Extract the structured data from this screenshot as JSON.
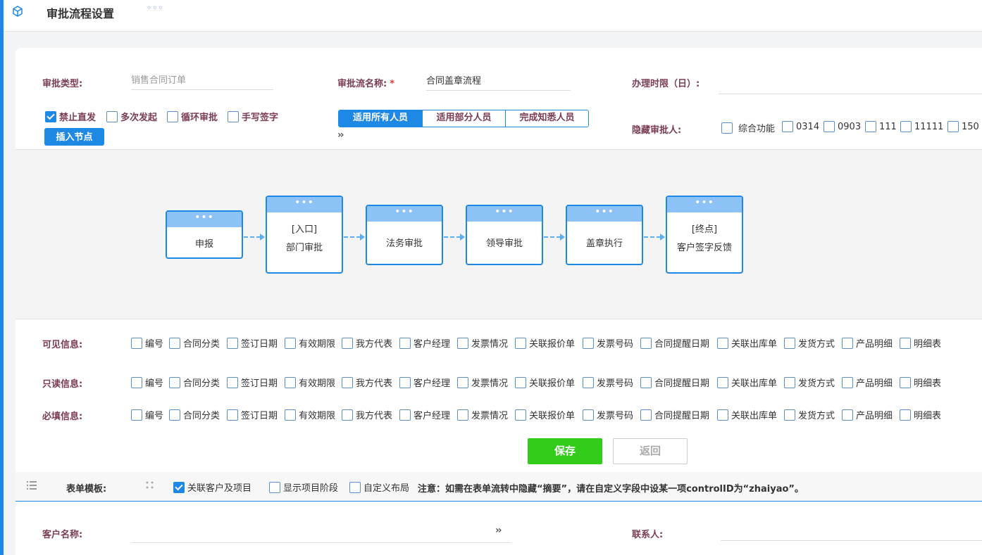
{
  "header": {
    "title": "审批流程设置",
    "more": "◦◦◦"
  },
  "form": {
    "type_label": "审批类型:",
    "type_placeholder": "销售合同订单",
    "name_label": "审批流名称:",
    "name_required": "*",
    "name_value": "合同盖章流程",
    "deadline_label": "办理时限（日）:",
    "deadline_value": ""
  },
  "options": [
    {
      "label": "禁止直发",
      "checked": true
    },
    {
      "label": "多次发起",
      "checked": false
    },
    {
      "label": "循环审批",
      "checked": false
    },
    {
      "label": "手写签字",
      "checked": false
    }
  ],
  "insert_node_label": "插入节点",
  "scope_tabs": [
    {
      "label": "适用所有人员",
      "active": true
    },
    {
      "label": "适用部分人员",
      "active": false
    },
    {
      "label": "完成知悉人员",
      "active": false
    }
  ],
  "hidden_approver": {
    "label": "隐藏审批人:",
    "items": [
      "综合功能",
      "0314",
      "0903",
      "111",
      "11111",
      "150"
    ]
  },
  "flow_nodes": [
    {
      "line1": "",
      "line2": "申报"
    },
    {
      "line1": "[入口]",
      "line2": "部门审批"
    },
    {
      "line1": "",
      "line2": "法务审批"
    },
    {
      "line1": "",
      "line2": "领导审批"
    },
    {
      "line1": "",
      "line2": "盖章执行"
    },
    {
      "line1": "[终点]",
      "line2": "客户签字反馈"
    }
  ],
  "node_head": "•••",
  "fields": [
    "编号",
    "合同分类",
    "签订日期",
    "有效期限",
    "我方代表",
    "客户经理",
    "发票情况",
    "关联报价单",
    "发票号码",
    "合同提醒日期",
    "关联出库单",
    "发货方式",
    "产品明细",
    "明细表"
  ],
  "visible_label": "可见信息:",
  "readonly_label": "只读信息:",
  "required_label": "必填信息:",
  "save_label": "保存",
  "back_label": "返回",
  "template": {
    "label": "表单模板:",
    "options": [
      {
        "label": "关联客户及项目",
        "checked": true
      },
      {
        "label": "显示项目阶段",
        "checked": false
      },
      {
        "label": "自定义布局",
        "checked": false
      }
    ],
    "note": "注意：如需在表单流转中隐藏“摘要”，请在自定义字段中设某一项controlID为“zhaiyao”。"
  },
  "customer_label": "客户名称:",
  "contact_label": "联系人:",
  "chevrons": "››"
}
